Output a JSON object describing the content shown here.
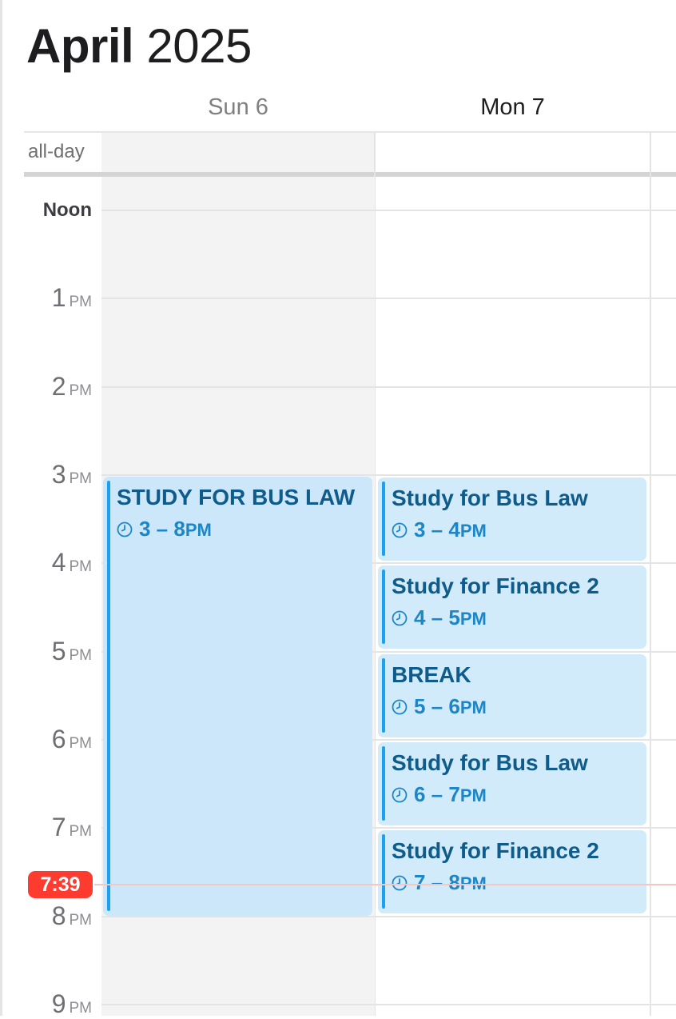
{
  "header": {
    "month": "April",
    "year": "2025"
  },
  "days": [
    {
      "label": "Sun 6",
      "weekend": true
    },
    {
      "label": "Mon 7",
      "weekend": false
    }
  ],
  "allday": {
    "label": "all-day"
  },
  "hours": [
    {
      "num": "Noon",
      "ap": ""
    },
    {
      "num": "1",
      "ap": "PM"
    },
    {
      "num": "2",
      "ap": "PM"
    },
    {
      "num": "3",
      "ap": "PM"
    },
    {
      "num": "4",
      "ap": "PM"
    },
    {
      "num": "5",
      "ap": "PM"
    },
    {
      "num": "6",
      "ap": "PM"
    },
    {
      "num": "7",
      "ap": "PM"
    },
    {
      "num": "8",
      "ap": "PM"
    },
    {
      "num": "9",
      "ap": "PM"
    }
  ],
  "now": {
    "label": "7:39"
  },
  "events": [
    {
      "day": "Sun 6",
      "title": "STUDY FOR BUS LAW",
      "range": "3 – 8",
      "suffix": "PM"
    },
    {
      "day": "Mon 7",
      "title": "Study for Bus Law",
      "range": "3 – 4",
      "suffix": "PM"
    },
    {
      "day": "Mon 7",
      "title": "Study for Finance 2",
      "range": "4 – 5",
      "suffix": "PM"
    },
    {
      "day": "Mon 7",
      "title": "BREAK",
      "range": "5 – 6",
      "suffix": "PM"
    },
    {
      "day": "Mon 7",
      "title": "Study for Bus Law",
      "range": "6 – 7",
      "suffix": "PM"
    },
    {
      "day": "Mon 7",
      "title": "Study for Finance 2",
      "range": "7 – 8",
      "suffix": "PM"
    }
  ],
  "colors": {
    "event_fill": "#d2ebfa",
    "event_accent": "#1aa1f2",
    "event_title": "#0f5b8a",
    "now": "#ff3b30"
  }
}
